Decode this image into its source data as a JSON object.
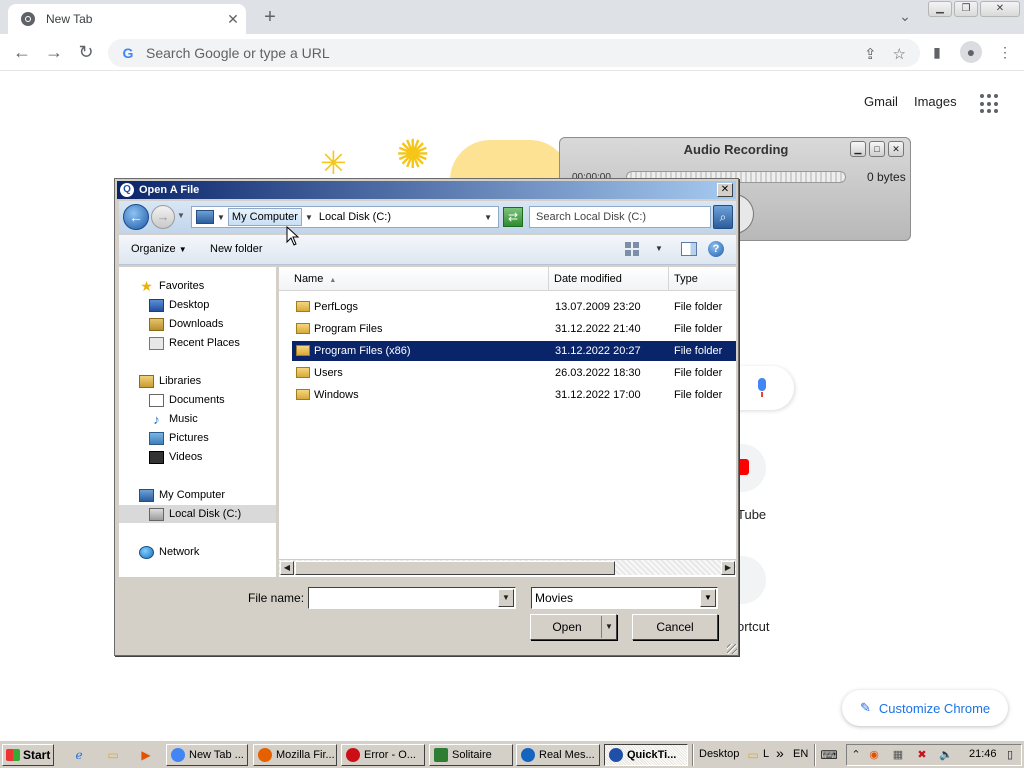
{
  "chrome": {
    "tab_title": "New Tab",
    "tab_close": "✕",
    "new_tab": "+",
    "tab_search": "⌄",
    "omnibox_placeholder": "Search Google or type a URL",
    "ntp_links": [
      "Gmail",
      "Images"
    ],
    "shortcut_youtube_label": "Tube",
    "shortcut_add_label": "ortcut",
    "customize_label": "Customize Chrome"
  },
  "audio_recording": {
    "title": "Audio Recording",
    "time": "00:00:00",
    "bytes": "0 bytes"
  },
  "dialog": {
    "title": "Open A File",
    "address": {
      "crumb_1": "My Computer",
      "crumb_2": "Local Disk (C:)"
    },
    "search_placeholder": "Search Local Disk (C:)",
    "toolbar": {
      "organize": "Organize",
      "new_folder": "New folder",
      "help": "?"
    },
    "nav": [
      {
        "label": "Favorites",
        "icon": "star-icon"
      },
      {
        "label": "Desktop",
        "icon": "desktop-icon"
      },
      {
        "label": "Downloads",
        "icon": "downloads-icon"
      },
      {
        "label": "Recent Places",
        "icon": "recent-places-icon"
      },
      {
        "label": "Libraries",
        "icon": "libraries-icon"
      },
      {
        "label": "Documents",
        "icon": "documents-icon"
      },
      {
        "label": "Music",
        "icon": "music-icon"
      },
      {
        "label": "Pictures",
        "icon": "pictures-icon"
      },
      {
        "label": "Videos",
        "icon": "videos-icon"
      },
      {
        "label": "My Computer",
        "icon": "computer-icon"
      },
      {
        "label": "Local Disk (C:)",
        "icon": "disk-icon",
        "selected": true
      },
      {
        "label": "Network",
        "icon": "network-icon"
      }
    ],
    "columns": [
      "Name",
      "Date modified",
      "Type"
    ],
    "files": [
      {
        "name": "PerfLogs",
        "date": "13.07.2009 23:20",
        "type": "File folder"
      },
      {
        "name": "Program Files",
        "date": "31.12.2022 21:40",
        "type": "File folder"
      },
      {
        "name": "Program Files (x86)",
        "date": "31.12.2022 20:27",
        "type": "File folder",
        "selected": true
      },
      {
        "name": "Users",
        "date": "26.03.2022 18:30",
        "type": "File folder"
      },
      {
        "name": "Windows",
        "date": "31.12.2022 17:00",
        "type": "File folder"
      }
    ],
    "file_name_label": "File name:",
    "file_name_value": "",
    "file_type_value": "Movies",
    "open_label": "Open",
    "cancel_label": "Cancel"
  },
  "taskbar": {
    "start_label": "Start",
    "tasks": [
      {
        "label": "New Tab ...",
        "color": "#4285f4"
      },
      {
        "label": "Mozilla Fir...",
        "color": "#e66000"
      },
      {
        "label": "Error - O...",
        "color": "#cc0f16"
      },
      {
        "label": "Solitaire",
        "color": "#2e7d32"
      },
      {
        "label": "Real Mes...",
        "color": "#1565c0"
      },
      {
        "label": "QuickTi...",
        "color": "#1f4fa8",
        "active": true
      }
    ],
    "desktop_label": "Desktop",
    "desktop_more": "L",
    "overflow": "»",
    "lang": "EN",
    "clock": "21:46"
  }
}
